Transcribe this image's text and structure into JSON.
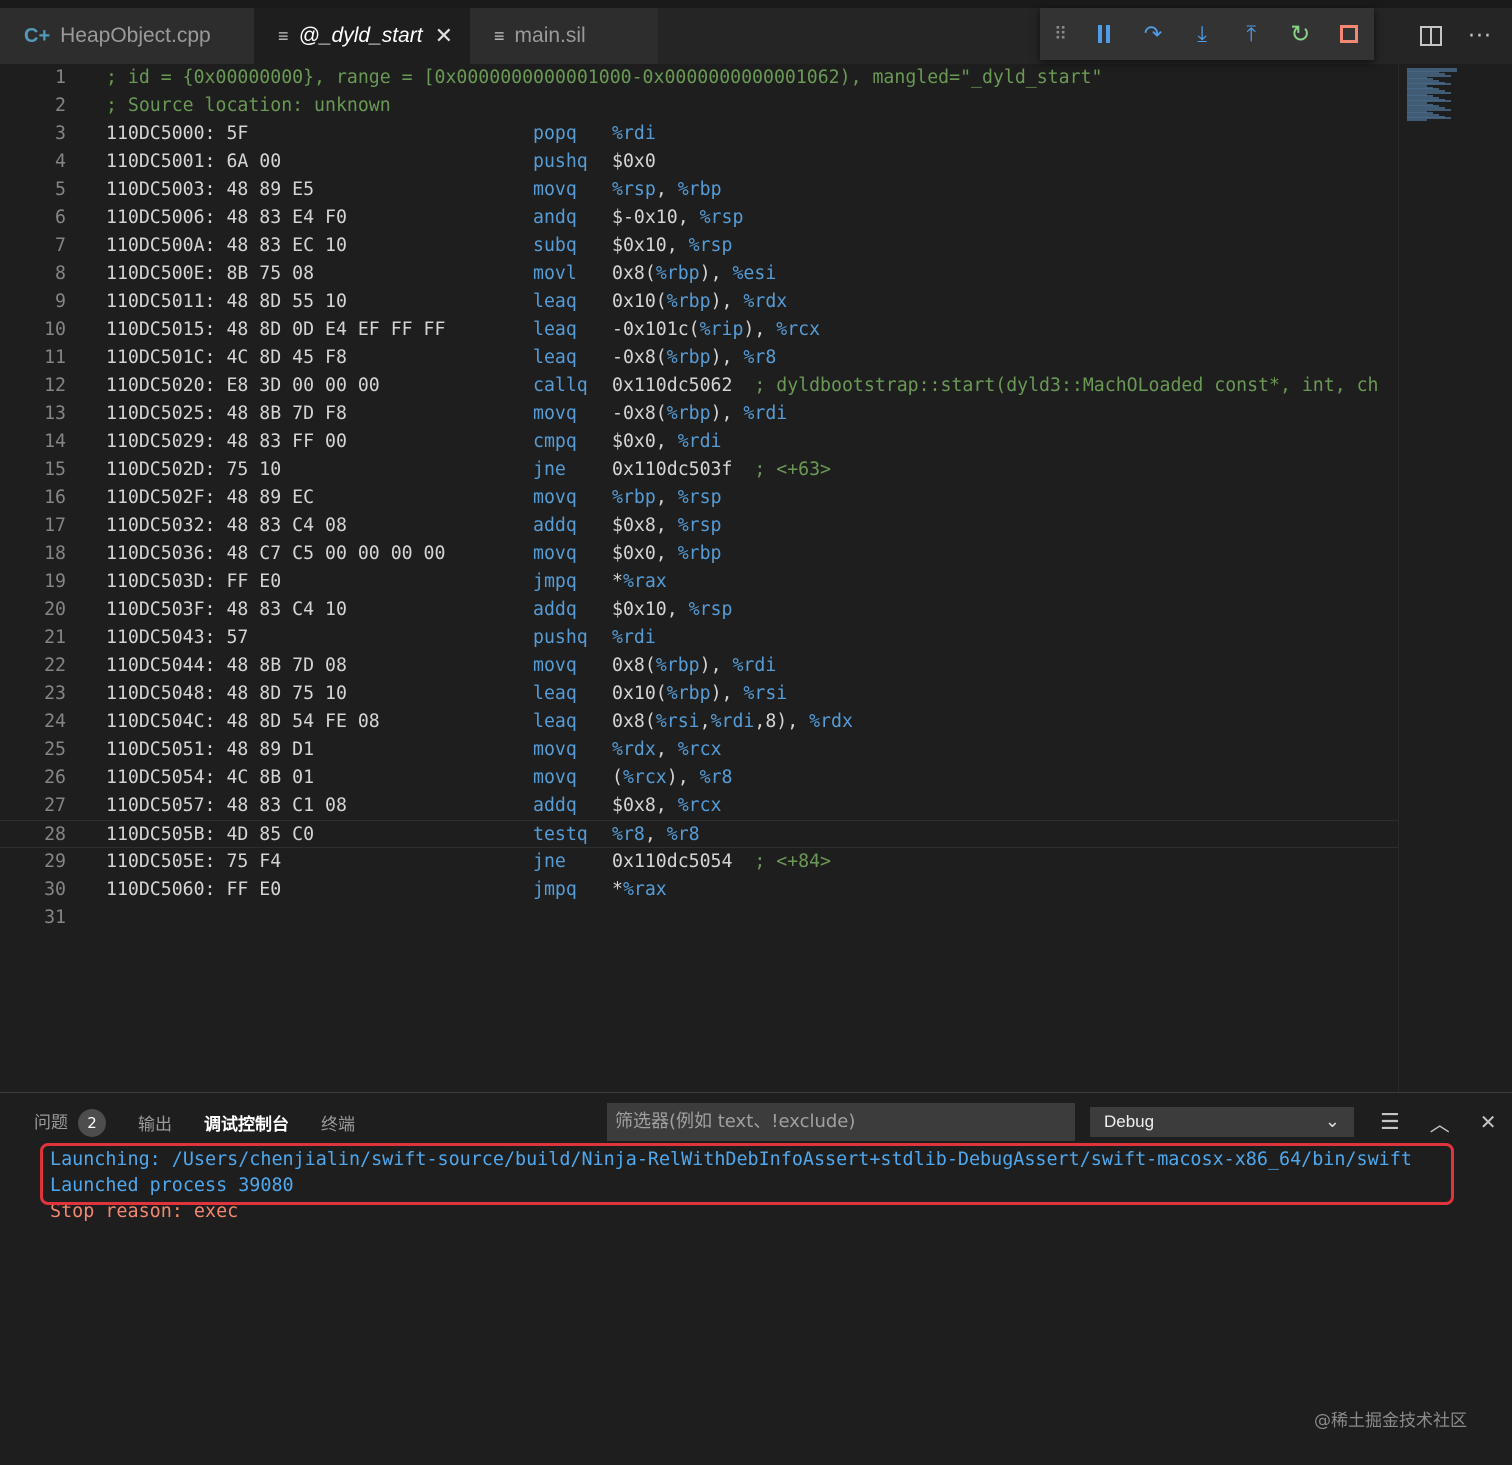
{
  "tabs": [
    {
      "label": "HeapObject.cpp",
      "icon": "cpp-file-icon",
      "active": false
    },
    {
      "label": "@_dyld_start",
      "icon": "disassembly-file-icon",
      "active": true
    },
    {
      "label": "main.sil",
      "icon": "text-file-icon",
      "active": false
    }
  ],
  "debug_toolbar": [
    "drag-handle",
    "pause",
    "step-over",
    "step-into",
    "step-out",
    "restart",
    "stop"
  ],
  "editor": {
    "header_comments": [
      "; id = {0x00000000}, range = [0x0000000000001000-0x0000000000001062), mangled=\"_dyld_start\"",
      "; Source location: unknown"
    ],
    "instructions": [
      {
        "addr": "110DC5000: 5F",
        "mnem": "popq",
        "ops": "%rdi",
        "cmt": ""
      },
      {
        "addr": "110DC5001: 6A 00",
        "mnem": "pushq",
        "ops": "$0x0",
        "cmt": ""
      },
      {
        "addr": "110DC5003: 48 89 E5",
        "mnem": "movq",
        "ops": "%rsp, %rbp",
        "cmt": ""
      },
      {
        "addr": "110DC5006: 48 83 E4 F0",
        "mnem": "andq",
        "ops": "$-0x10, %rsp",
        "cmt": ""
      },
      {
        "addr": "110DC500A: 48 83 EC 10",
        "mnem": "subq",
        "ops": "$0x10, %rsp",
        "cmt": ""
      },
      {
        "addr": "110DC500E: 8B 75 08",
        "mnem": "movl",
        "ops": "0x8(%rbp), %esi",
        "cmt": ""
      },
      {
        "addr": "110DC5011: 48 8D 55 10",
        "mnem": "leaq",
        "ops": "0x10(%rbp), %rdx",
        "cmt": ""
      },
      {
        "addr": "110DC5015: 48 8D 0D E4 EF FF FF",
        "mnem": "leaq",
        "ops": "-0x101c(%rip), %rcx",
        "cmt": ""
      },
      {
        "addr": "110DC501C: 4C 8D 45 F8",
        "mnem": "leaq",
        "ops": "-0x8(%rbp), %r8",
        "cmt": ""
      },
      {
        "addr": "110DC5020: E8 3D 00 00 00",
        "mnem": "callq",
        "ops": "0x110dc5062",
        "cmt": "  ; dyldbootstrap::start(dyld3::MachOLoaded const*, int, ch"
      },
      {
        "addr": "110DC5025: 48 8B 7D F8",
        "mnem": "movq",
        "ops": "-0x8(%rbp), %rdi",
        "cmt": ""
      },
      {
        "addr": "110DC5029: 48 83 FF 00",
        "mnem": "cmpq",
        "ops": "$0x0, %rdi",
        "cmt": ""
      },
      {
        "addr": "110DC502D: 75 10",
        "mnem": "jne",
        "ops": "0x110dc503f",
        "cmt": "  ; <+63>"
      },
      {
        "addr": "110DC502F: 48 89 EC",
        "mnem": "movq",
        "ops": "%rbp, %rsp",
        "cmt": ""
      },
      {
        "addr": "110DC5032: 48 83 C4 08",
        "mnem": "addq",
        "ops": "$0x8, %rsp",
        "cmt": ""
      },
      {
        "addr": "110DC5036: 48 C7 C5 00 00 00 00",
        "mnem": "movq",
        "ops": "$0x0, %rbp",
        "cmt": ""
      },
      {
        "addr": "110DC503D: FF E0",
        "mnem": "jmpq",
        "ops": "*%rax",
        "cmt": ""
      },
      {
        "addr": "110DC503F: 48 83 C4 10",
        "mnem": "addq",
        "ops": "$0x10, %rsp",
        "cmt": ""
      },
      {
        "addr": "110DC5043: 57",
        "mnem": "pushq",
        "ops": "%rdi",
        "cmt": ""
      },
      {
        "addr": "110DC5044: 48 8B 7D 08",
        "mnem": "movq",
        "ops": "0x8(%rbp), %rdi",
        "cmt": ""
      },
      {
        "addr": "110DC5048: 48 8D 75 10",
        "mnem": "leaq",
        "ops": "0x10(%rbp), %rsi",
        "cmt": ""
      },
      {
        "addr": "110DC504C: 48 8D 54 FE 08",
        "mnem": "leaq",
        "ops": "0x8(%rsi,%rdi,8), %rdx",
        "cmt": ""
      },
      {
        "addr": "110DC5051: 48 89 D1",
        "mnem": "movq",
        "ops": "%rdx, %rcx",
        "cmt": ""
      },
      {
        "addr": "110DC5054: 4C 8B 01",
        "mnem": "movq",
        "ops": "(%rcx), %r8",
        "cmt": ""
      },
      {
        "addr": "110DC5057: 48 83 C1 08",
        "mnem": "addq",
        "ops": "$0x8, %rcx",
        "cmt": ""
      },
      {
        "addr": "110DC505B: 4D 85 C0",
        "mnem": "testq",
        "ops": "%r8, %r8",
        "cmt": "",
        "current": true
      },
      {
        "addr": "110DC505E: 75 F4",
        "mnem": "jne",
        "ops": "0x110dc5054",
        "cmt": "  ; <+84>"
      },
      {
        "addr": "110DC5060: FF E0",
        "mnem": "jmpq",
        "ops": "*%rax",
        "cmt": ""
      }
    ],
    "total_lines": 31
  },
  "panel": {
    "tabs": [
      {
        "label": "问题",
        "badge": "2",
        "active": false
      },
      {
        "label": "输出",
        "active": false
      },
      {
        "label": "调试控制台",
        "active": true
      },
      {
        "label": "终端",
        "active": false
      }
    ],
    "filter_placeholder": "筛选器(例如 text、!exclude)",
    "debug_select": "Debug",
    "console_lines": [
      {
        "text": "Launching: /Users/chenjialin/swift-source/build/Ninja-RelWithDebInfoAssert+stdlib-DebugAssert/swift-macosx-x86_64/bin/swift",
        "color": "blue"
      },
      {
        "text": "Launched process 39080",
        "color": "blue"
      },
      {
        "text": "Stop reason: exec",
        "color": "red"
      }
    ]
  },
  "watermark": "@稀土掘金技术社区",
  "colors": {
    "background": "#1e1e1e",
    "keyword": "#569cd6",
    "comment": "#6a9955",
    "highlight_box": "#e0343c"
  }
}
